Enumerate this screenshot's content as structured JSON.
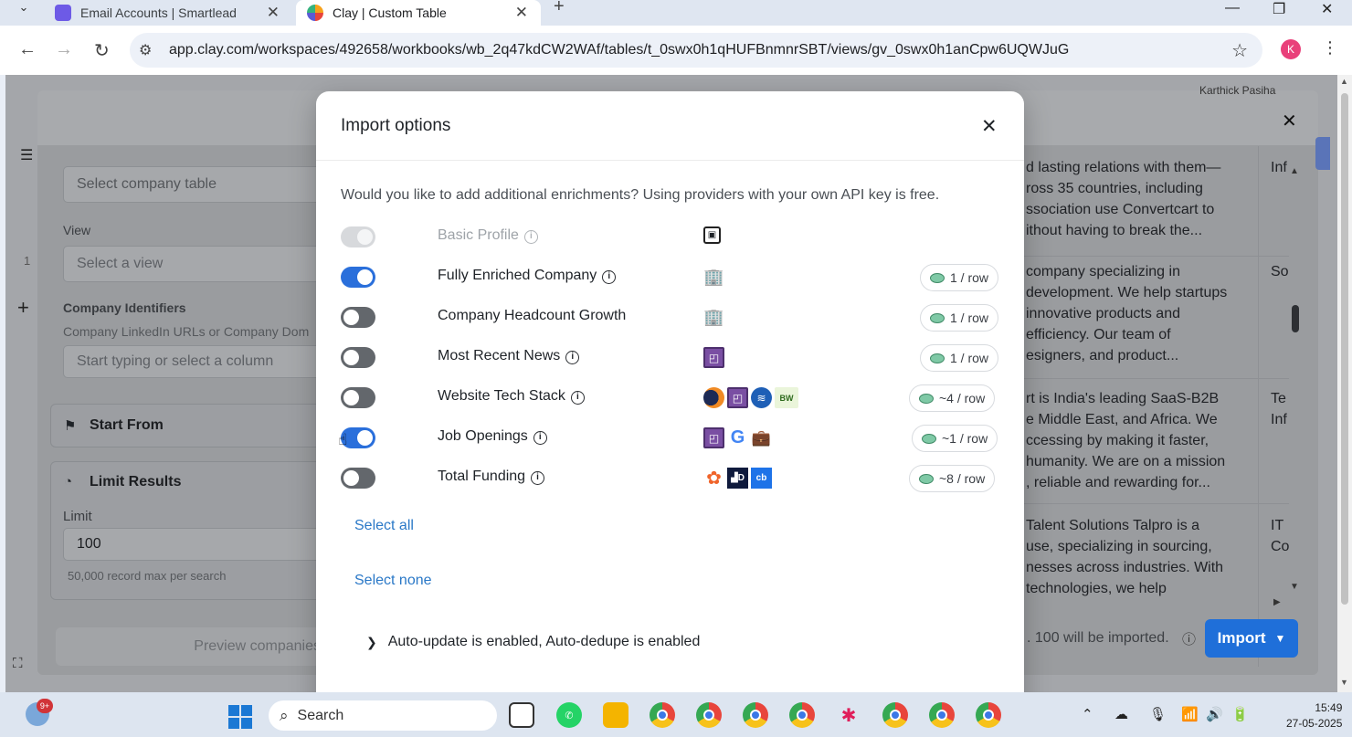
{
  "browser": {
    "tabs": [
      {
        "title": "Email Accounts | Smartlead",
        "active": false
      },
      {
        "title": "Clay | Custom Table",
        "active": true
      }
    ],
    "url": "app.clay.com/workspaces/492658/workbooks/wb_2q47kdCW2WAf/tables/t_0swx0h1qHUFBnmnrSBT/views/gv_0swx0h1anCpw6UQWJuG",
    "profile_initial": "K"
  },
  "background": {
    "left_panel": {
      "company_table_placeholder": "Select company table",
      "view_label": "View",
      "view_placeholder": "Select a view",
      "identifiers_label": "Company Identifiers",
      "identifiers_hint": "Company LinkedIn URLs or Company Dom",
      "identifiers_placeholder": "Start typing or select a column",
      "start_from_label": "Start From",
      "limit_results_label": "Limit Results",
      "limit_label": "Limit",
      "limit_value": "100",
      "limit_hint": "50,000 record max per search",
      "preview_button": "Preview companies"
    },
    "table_rows": [
      {
        "desc": [
          "d lasting relations with them—",
          "ross 35 countries, including",
          "ssociation use Convertcart to",
          "ithout having to break the..."
        ],
        "col2": [
          "Inf"
        ]
      },
      {
        "desc": [
          "company specializing in",
          "development. We help startups",
          "innovative products and",
          "efficiency. Our team of",
          "esigners, and product..."
        ],
        "col2": [
          "So"
        ]
      },
      {
        "desc": [
          "rt is India's leading SaaS-B2B",
          "e Middle East, and Africa. We",
          "ccessing by making it faster,",
          "humanity. We are on a mission",
          ", reliable and rewarding for..."
        ],
        "col2": [
          "Te",
          "Inf"
        ]
      },
      {
        "desc": [
          "Talent Solutions Talpro is a",
          "use, specializing in sourcing,",
          "nesses across industries. With",
          "technologies, we help"
        ],
        "col2": [
          "IT",
          "Co"
        ]
      }
    ],
    "footer_text": ". 100 will be imported.",
    "import_button": "Import",
    "top_right_user": "Karthick Pasiha"
  },
  "modal": {
    "title": "Import options",
    "description": "Would you like to add additional enrichments? Using providers with your own API key is free.",
    "enrichments": [
      {
        "label": "Basic Profile",
        "state": "disabled",
        "info": true,
        "providers": [
          "profile-card-icon"
        ],
        "cost": ""
      },
      {
        "label": "Fully Enriched Company",
        "state": "on",
        "info": true,
        "providers": [
          "building-icon"
        ],
        "cost": "1 / row"
      },
      {
        "label": "Company Headcount Growth",
        "state": "off",
        "info": false,
        "providers": [
          "building-icon"
        ],
        "cost": "1 / row"
      },
      {
        "label": "Most Recent News",
        "state": "off",
        "info": true,
        "providers": [
          "clay-logo-icon"
        ],
        "cost": "1 / row"
      },
      {
        "label": "Website Tech Stack",
        "state": "off",
        "info": true,
        "providers": [
          "similarweb-icon",
          "clay-logo-icon",
          "wappalyzer-icon",
          "builtwith-icon"
        ],
        "cost": "~4 / row"
      },
      {
        "label": "Job Openings",
        "state": "on",
        "info": true,
        "providers": [
          "clay-logo-icon",
          "google-icon",
          "briefcase-icon"
        ],
        "cost": "~1 / row"
      },
      {
        "label": "Total Funding",
        "state": "off",
        "info": true,
        "providers": [
          "dealroom-icon",
          "dealfront-icon",
          "crunchbase-icon"
        ],
        "cost": "~8 / row"
      }
    ],
    "select_all": "Select all",
    "select_none": "Select none",
    "auto_update_text": "Auto-update is enabled, Auto-dedupe is enabled"
  },
  "taskbar": {
    "notification_count": "9+",
    "search_placeholder": "Search",
    "time": "15:49",
    "date": "27-05-2025"
  }
}
